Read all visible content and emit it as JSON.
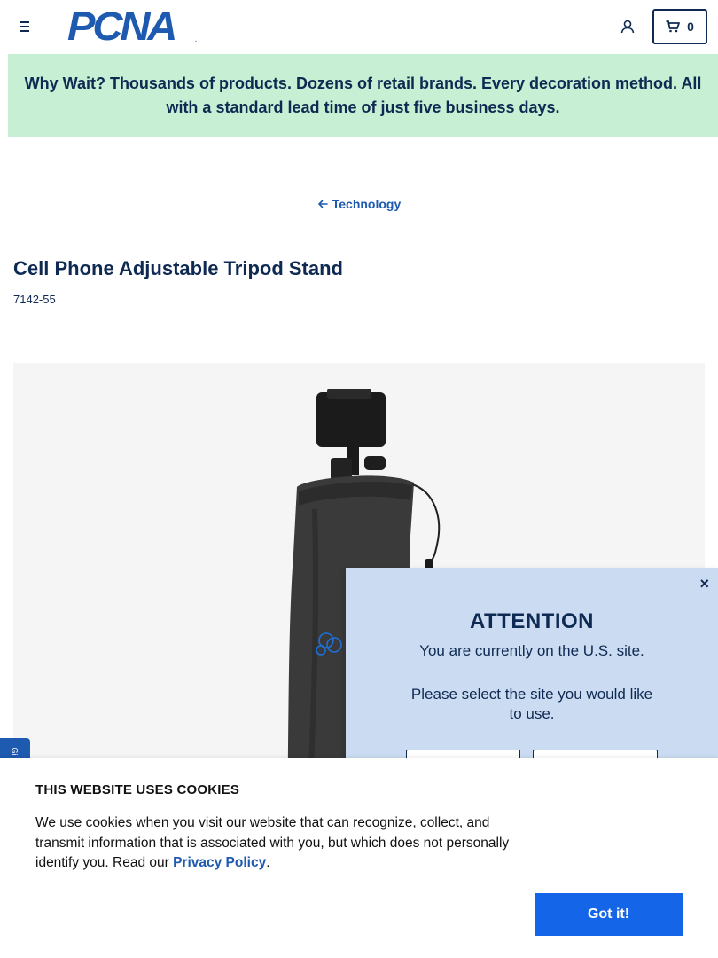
{
  "header": {
    "logo_text": "PCNA",
    "logo_mark": ".",
    "cart_count": "0",
    "icons": [
      "menu-icon",
      "user-icon",
      "cart-icon"
    ]
  },
  "promo": {
    "text": "Why Wait? Thousands of products. Dozens of retail brands. Every decoration method. All with a standard lead time of just five business days."
  },
  "breadcrumb": {
    "label": "Technology"
  },
  "product": {
    "title": "Cell Phone Adjustable Tripod Stand",
    "sku": "7142-55"
  },
  "attention": {
    "title": "ATTENTION",
    "message": "You are currently on the U.S. site.",
    "prompt": "Please select the site you would like to use.",
    "close": "×"
  },
  "side_tab": {
    "label": "Gi"
  },
  "cookie": {
    "title": "THIS WEBSITE USES COOKIES",
    "body": "We use cookies when you visit our website that can recognize, collect, and transmit information that is associated with you, but which does not personally identify you. Read our ",
    "link": "Privacy Policy",
    "period": ".",
    "button": "Got it!"
  },
  "colors": {
    "navy": "#0f2a52",
    "brand_blue": "#1e5ab0",
    "promo_bg": "#c6efd4",
    "popup_bg": "#cbdcf2",
    "cookie_button": "#1565e8"
  }
}
